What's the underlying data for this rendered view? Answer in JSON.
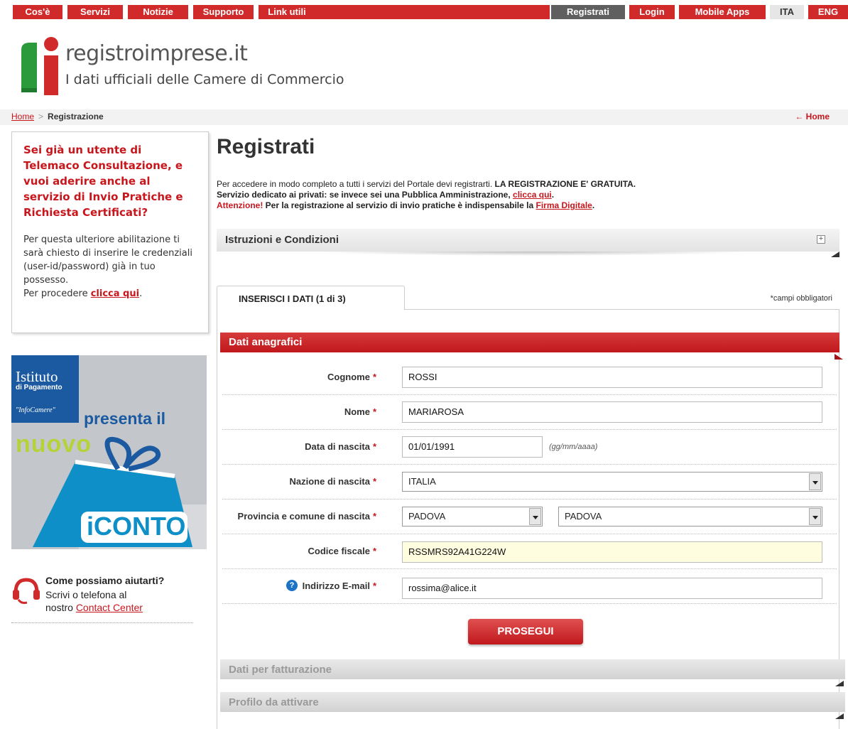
{
  "colors": {
    "brand_red": "#d12a2a",
    "dark_tab": "#5f5f5f",
    "light_tab": "#e6e6e6",
    "logo_green": "#2a9a3a"
  },
  "topnav": {
    "left": [
      "Cos'è",
      "Servizi",
      "Notizie",
      "Supporto",
      "Link utili"
    ],
    "right": {
      "register": "Registrati",
      "login": "Login",
      "apps": "Mobile Apps",
      "ita": "ITA",
      "eng": "ENG"
    }
  },
  "logo": {
    "title": "registroimprese.it",
    "subtitle": "I dati ufficiali delle Camere di Commercio"
  },
  "breadcrumb": {
    "home": "Home",
    "sep": ">",
    "current": "Registrazione",
    "back_home": "Home"
  },
  "sidebar": {
    "promo_heading": "Sei già un utente di Telemaco Consultazione, e vuoi aderire anche al servizio di Invio Pratiche e Richiesta Certificati?",
    "promo_text": "Per questa ulteriore abilitazione ti sarà chiesto di inserire le credenziali (user-id/password) già in tuo possesso.",
    "promo_cta_prefix": "Per procedere",
    "promo_cta_link": "clicca qui",
    "promo_cta_suffix": ".",
    "banner": {
      "line1": "Istituto",
      "line2": "di Pagamento",
      "line3": "\"InfoCamere\"",
      "line4": "presenta il",
      "line5": "nuovo",
      "line6": "iCONTO"
    },
    "help_title": "Come possiamo aiutarti?",
    "help_line1": "Scrivi o telefona al",
    "help_line2_prefix": "nostro",
    "help_link": "Contact Center"
  },
  "main": {
    "title": "Registrati",
    "intro_line1": "Per accedere in modo completo a tutti i servizi del Portale devi registrarti.",
    "intro_line1_bold": "LA REGISTRAZIONE E' GRATUITA.",
    "intro_line2": "Servizio dedicato ai privati: se invece sei una Pubblica Amministrazione,",
    "intro_line2_link": "clicca qui",
    "intro_line2_end": ".",
    "intro_line3_red": "Attenzione!",
    "intro_line3": "Per la registrazione al servizio di invio pratiche è indispensabile la",
    "intro_line3_link": "Firma Digitale",
    "intro_line3_end": ".",
    "istruzioni": "Istruzioni e Condizioni",
    "istruzioni_toggle": "+",
    "tab": "INSERISCI I DATI (1 di 3)",
    "required_note": "*campi obbligatori",
    "section": "Dati anagrafici",
    "required_star": "*",
    "fields": {
      "cognome": {
        "label": "Cognome",
        "value": "ROSSI"
      },
      "nome": {
        "label": "Nome",
        "value": "MARIAROSA"
      },
      "nascita": {
        "label": "Data di nascita",
        "value": "01/01/1991",
        "hint": "(gg/mm/aaaa)"
      },
      "nazione": {
        "label": "Nazione di nascita",
        "value": "ITALIA"
      },
      "provincia": {
        "label": "Provincia e comune di nascita",
        "value": "PADOVA",
        "comune_value": "PADOVA"
      },
      "codice": {
        "label": "Codice fiscale",
        "value": "RSSMRS92A41G224W"
      },
      "email": {
        "label": "Indirizzo E-mail",
        "value": "rossima@alice.it",
        "help_icon": "?"
      }
    },
    "submit": "PROSEGUI",
    "section2": "Dati per fatturazione",
    "section3": "Profilo da attivare"
  }
}
